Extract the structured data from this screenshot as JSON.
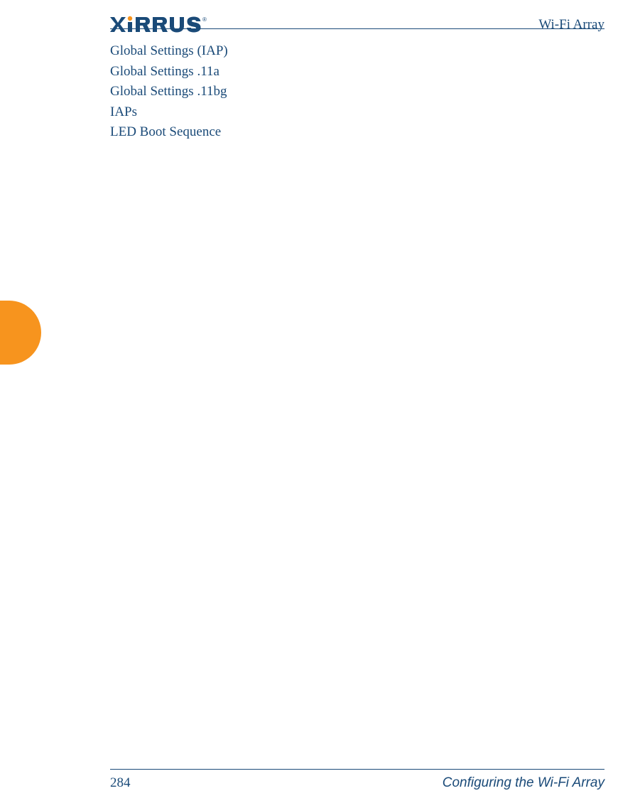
{
  "header": {
    "logo_text": "XIRRUS",
    "title": "Wi-Fi Array"
  },
  "toc": {
    "items": [
      "Global Settings (IAP)",
      "Global Settings .11a",
      "Global Settings .11bg",
      "IAPs",
      "LED Boot Sequence"
    ]
  },
  "footer": {
    "page_number": "284",
    "section_title": "Configuring the Wi-Fi Array"
  }
}
